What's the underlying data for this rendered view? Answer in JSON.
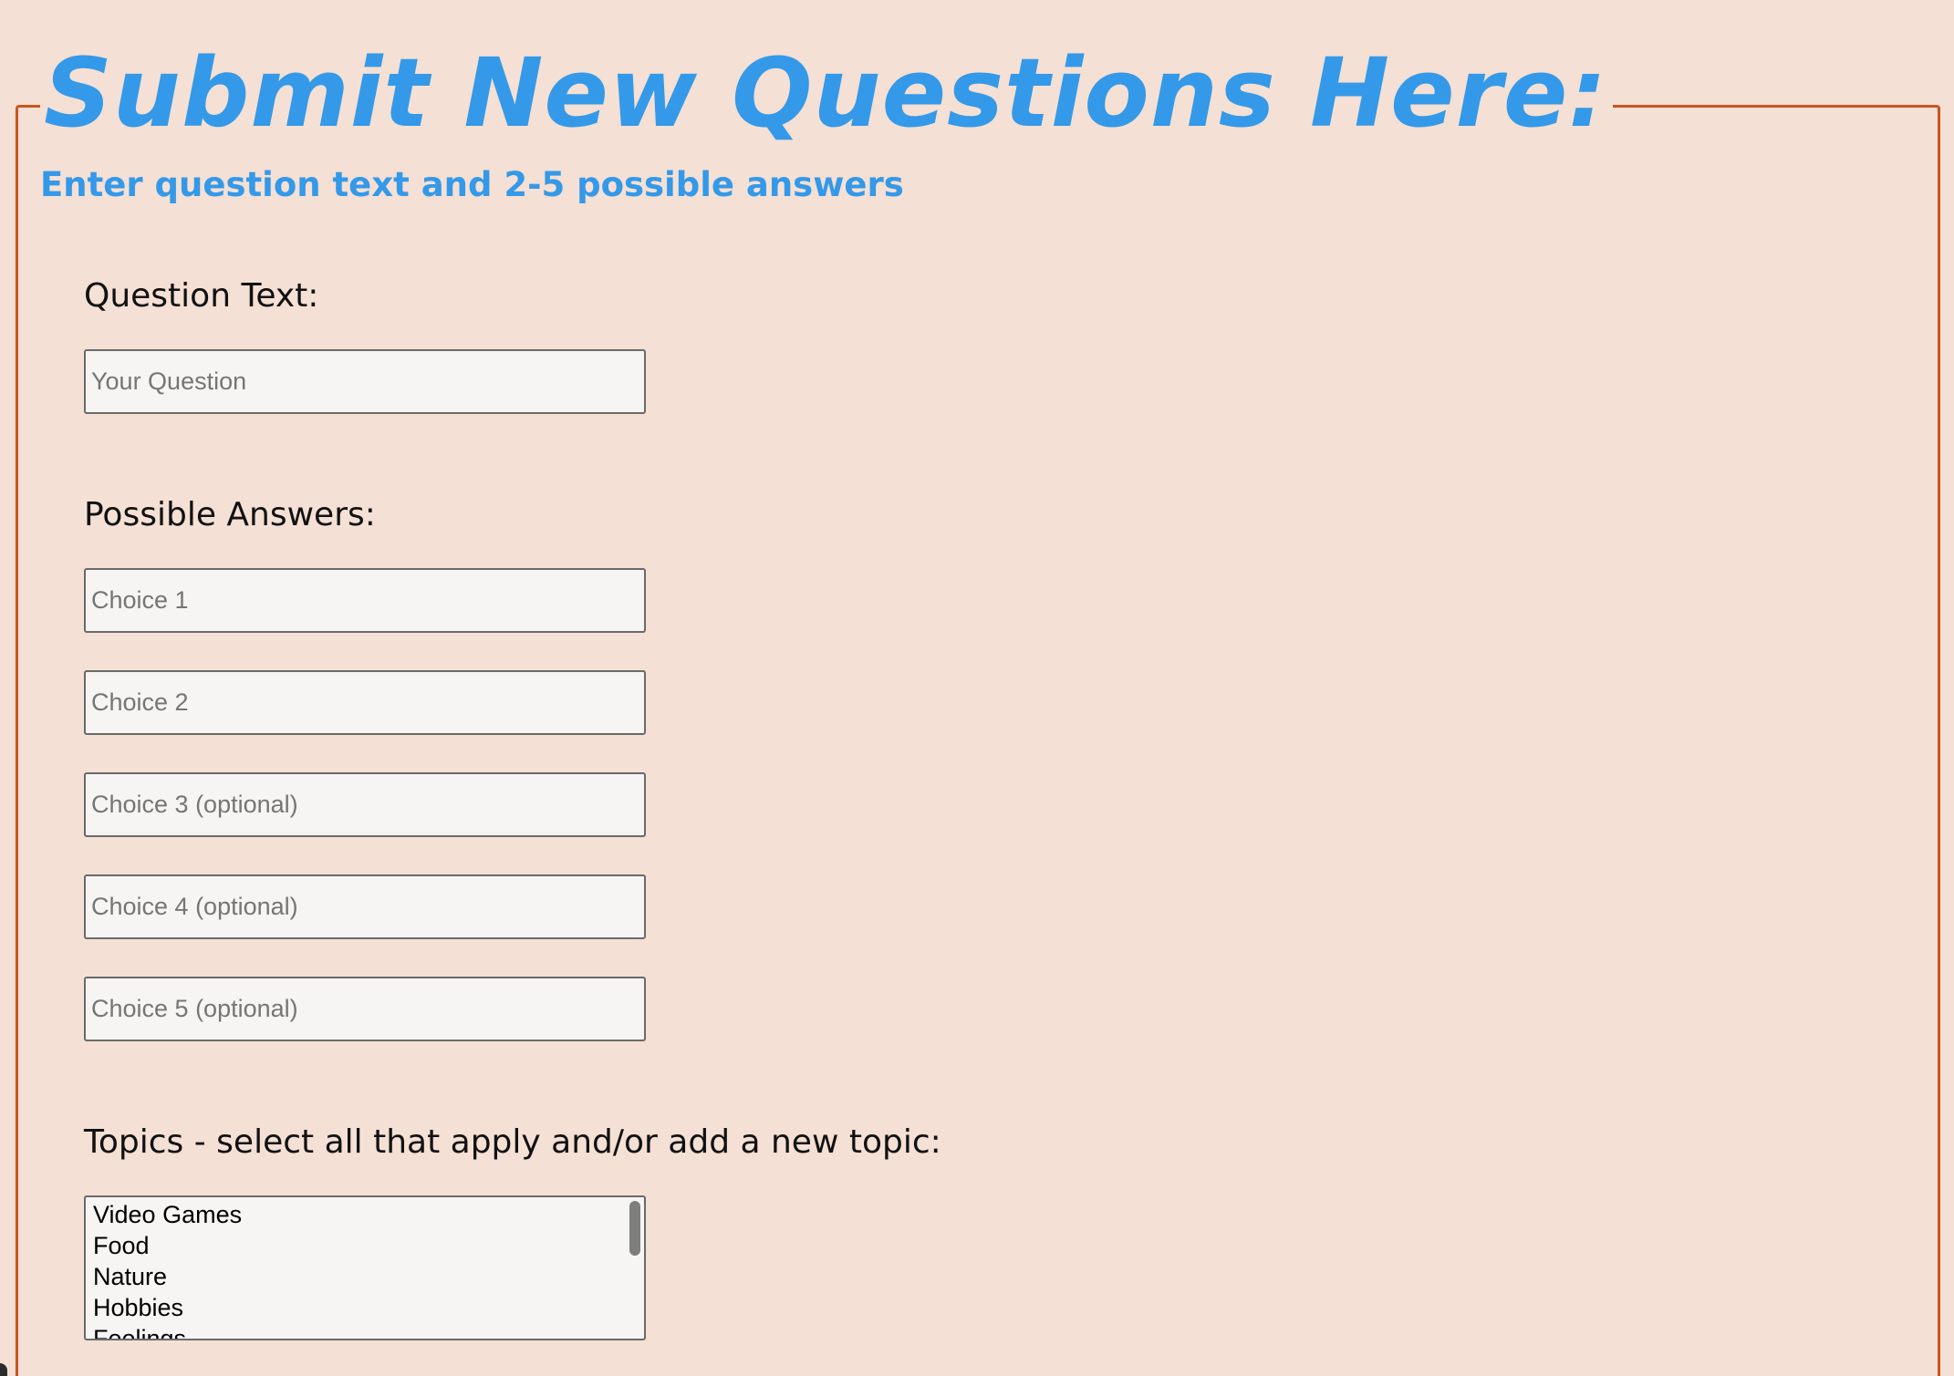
{
  "page": {
    "title": "Submit New Questions Here:",
    "subtitle": "Enter question text and 2-5 possible answers"
  },
  "question": {
    "label": "Question Text:",
    "placeholder": "Your Question"
  },
  "answers": {
    "label": "Possible Answers:",
    "choices": [
      {
        "placeholder": "Choice 1"
      },
      {
        "placeholder": "Choice 2"
      },
      {
        "placeholder": "Choice 3 (optional)"
      },
      {
        "placeholder": "Choice 4 (optional)"
      },
      {
        "placeholder": "Choice 5 (optional)"
      }
    ]
  },
  "topics": {
    "label": "Topics - select all that apply and/or add a new topic:",
    "options": [
      "Video Games",
      "Food",
      "Nature",
      "Hobbies",
      "Feelings"
    ]
  },
  "colors": {
    "accent": "#3499e8",
    "frame_border": "#c9561f",
    "background": "#f4e0d4",
    "field_background": "#f6f5f4"
  }
}
